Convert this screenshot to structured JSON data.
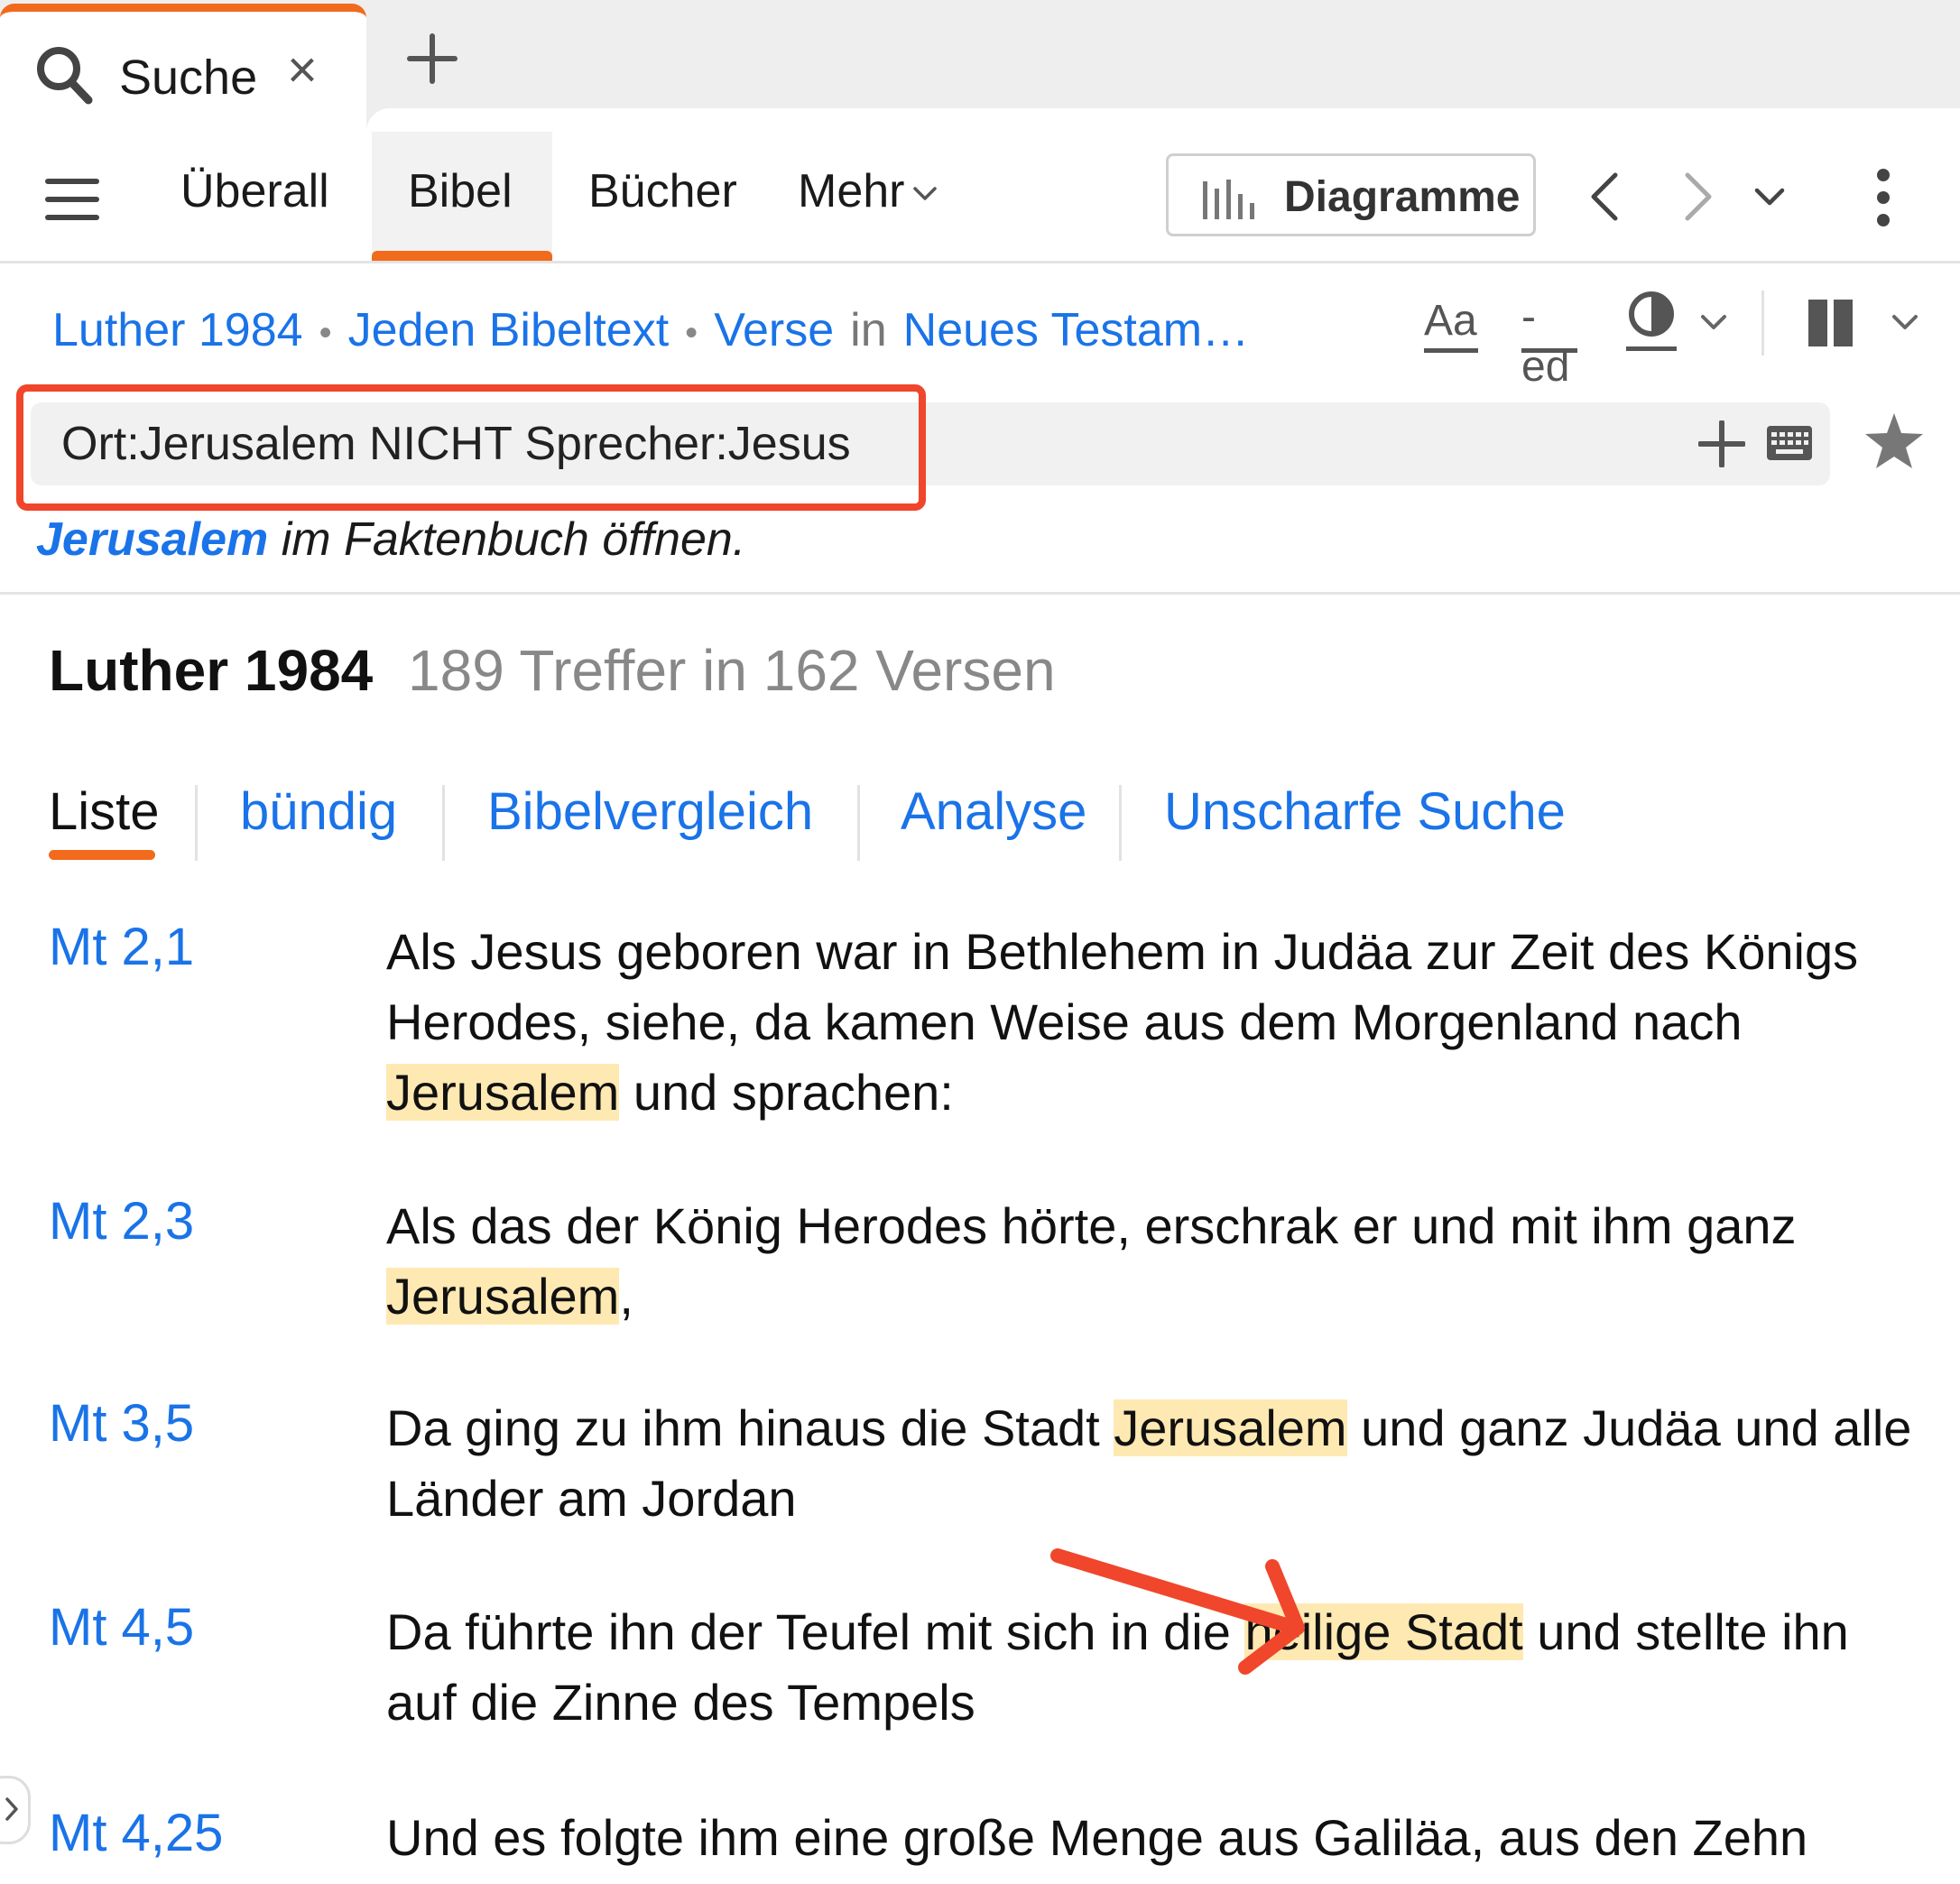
{
  "tabs": {
    "active_label": "Suche",
    "close_glyph": "×",
    "new_tab_icon": "plus-icon",
    "accent": "#f26a1b"
  },
  "nav": {
    "items": [
      "Überall",
      "Bibel",
      "Bücher",
      "Mehr"
    ],
    "selected": "Bibel",
    "diagram_button": "Diagramme"
  },
  "breadcrumb": {
    "version": "Luther 1984",
    "scope": "Jeden Bibeltext",
    "unit": "Verse",
    "in": "in",
    "range": "Neues Testam…"
  },
  "toolbar": {
    "font_label": "Aa",
    "inflection_label": "-ed"
  },
  "search": {
    "query": "Ort:Jerusalem NICHT Sprecher:Jesus",
    "fact_link": "Jerusalem",
    "fact_rest": " im Faktenbuch öffnen."
  },
  "results": {
    "title": "Luther 1984",
    "count": "189 Treffer in 162 Versen",
    "view_tabs": [
      "Liste",
      "bündig",
      "Bibelvergleich",
      "Analyse",
      "Unscharfe Suche"
    ],
    "selected_view": "Liste",
    "verses": [
      {
        "ref": "Mt 2,1",
        "before": "Als Jesus geboren war in Bethlehem in Judäa zur Zeit des Königs Herodes, siehe, da kamen Weise aus dem Morgenland nach ",
        "hit": "Jerusalem",
        "after": " und sprachen:"
      },
      {
        "ref": "Mt 2,3",
        "before": "Als das der König Herodes hörte, erschrak er und mit ihm ganz ",
        "hit": "Jerusalem",
        "after": ","
      },
      {
        "ref": "Mt 3,5",
        "before": "Da ging zu ihm hinaus die Stadt ",
        "hit": "Jerusalem",
        "after": " und ganz Judäa und alle Länder am Jordan"
      },
      {
        "ref": "Mt 4,5",
        "before": "Da führte ihn der Teufel mit sich in die ",
        "hit": "heilige Stadt",
        "after": " und stellte ihn auf die Zinne des Tempels"
      },
      {
        "ref": "Mt 4,25",
        "before": "Und es folgte ihm eine große Menge aus Galiläa, aus den Zehn",
        "hit": "",
        "after": ""
      }
    ],
    "highlight_color": "#ffe9b2",
    "link_color": "#1a73e8"
  },
  "annotation": {
    "box_color": "#f0462b"
  }
}
